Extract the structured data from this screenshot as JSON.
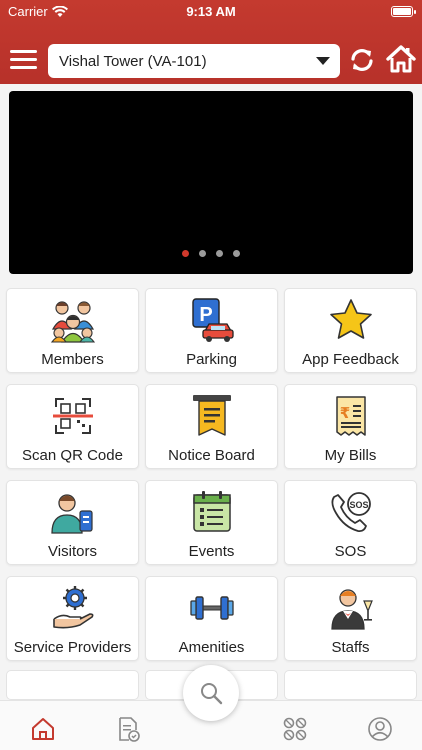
{
  "status_bar": {
    "carrier": "Carrier",
    "time": "9:13 AM"
  },
  "header": {
    "selected_tower": "Vishal Tower (VA-101)"
  },
  "banner": {
    "slides": 4,
    "active_slide": 1
  },
  "tiles": [
    {
      "label": "Members",
      "icon": "members-icon"
    },
    {
      "label": "Parking",
      "icon": "parking-icon"
    },
    {
      "label": "App Feedback",
      "icon": "star-icon"
    },
    {
      "label": "Scan QR Code",
      "icon": "qr-scan-icon"
    },
    {
      "label": "Notice Board",
      "icon": "notice-board-icon"
    },
    {
      "label": "My Bills",
      "icon": "bill-icon"
    },
    {
      "label": "Visitors",
      "icon": "visitor-icon"
    },
    {
      "label": "Events",
      "icon": "calendar-icon"
    },
    {
      "label": "SOS",
      "icon": "sos-phone-icon"
    },
    {
      "label": "Service Providers",
      "icon": "service-gear-icon"
    },
    {
      "label": "Amenities",
      "icon": "dumbbell-icon"
    },
    {
      "label": "Staffs",
      "icon": "waiter-icon"
    }
  ],
  "bottom_nav": [
    "home-icon",
    "document-icon",
    "search-icon",
    "apps-icon",
    "profile-icon"
  ],
  "colors": {
    "brand_red": "#c43a2f",
    "active_dot": "#d0392c"
  }
}
